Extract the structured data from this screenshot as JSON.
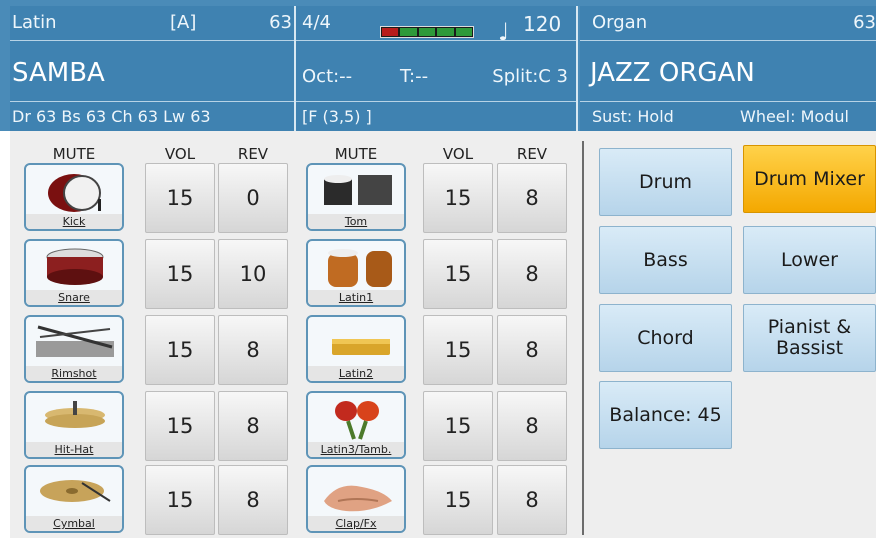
{
  "style": {
    "name": "Latin",
    "bank": "[A]",
    "number": "63",
    "title": "SAMBA",
    "volumes": "Dr 63   Bs 63  Ch 63  Lw 63"
  },
  "status": {
    "time_sig": "4/4",
    "tempo": "120",
    "octave": "Oct:--",
    "transpose": "T:--",
    "split": "Split:C 3",
    "chord": "[F        (3,5) ]",
    "meter_colors": [
      "#b81c1c",
      "#2e9a3a",
      "#2e9a3a",
      "#2e9a3a",
      "#2e9a3a"
    ]
  },
  "voice": {
    "bank": "Organ",
    "number": "63",
    "title": "JAZZ ORGAN",
    "sustain": "Sust: Hold",
    "wheel": "Wheel: Modul"
  },
  "columns": {
    "mute": "MUTE",
    "vol": "VOL",
    "rev": "REV"
  },
  "left_rows": [
    {
      "label": "Kick",
      "icon": "kick-drum-icon",
      "vol": "15",
      "rev": "0"
    },
    {
      "label": "Snare",
      "icon": "snare-drum-icon",
      "vol": "15",
      "rev": "10"
    },
    {
      "label": "Rimshot",
      "icon": "rimshot-icon",
      "vol": "15",
      "rev": "8"
    },
    {
      "label": "Hit-Hat",
      "icon": "hihat-icon",
      "vol": "15",
      "rev": "8"
    },
    {
      "label": "Cymbal",
      "icon": "cymbal-icon",
      "vol": "15",
      "rev": "8"
    }
  ],
  "right_rows": [
    {
      "label": "Tom",
      "icon": "tom-drums-icon",
      "vol": "15",
      "rev": "8"
    },
    {
      "label": "Latin1",
      "icon": "congas-icon",
      "vol": "15",
      "rev": "8"
    },
    {
      "label": "Latin2",
      "icon": "wood-block-icon",
      "vol": "15",
      "rev": "8"
    },
    {
      "label": "Latin3/Tamb.",
      "icon": "maracas-icon",
      "vol": "15",
      "rev": "8"
    },
    {
      "label": "Clap/Fx",
      "icon": "clap-hands-icon",
      "vol": "15",
      "rev": "8"
    }
  ],
  "side_buttons": {
    "drum": "Drum",
    "drum_mixer": "Drum Mixer",
    "bass": "Bass",
    "lower": "Lower",
    "chord": "Chord",
    "pianist_bassist": "Pianist & Bassist",
    "balance": "Balance: 45"
  },
  "colors": {
    "header": "#3f82b1",
    "active_button": "#f4a800"
  }
}
